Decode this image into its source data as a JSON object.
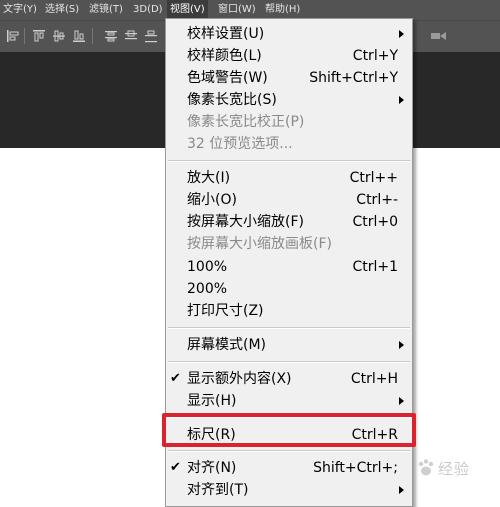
{
  "menubar": {
    "items": [
      {
        "label": "文字(Y)"
      },
      {
        "label": "选择(S)"
      },
      {
        "label": "滤镜(T)"
      },
      {
        "label": "3D(D)"
      },
      {
        "label": "视图(V)"
      },
      {
        "label": "窗口(W)"
      },
      {
        "label": "帮助(H)"
      }
    ]
  },
  "view_menu": {
    "items": [
      {
        "label": "校样设置(U)",
        "shortcut": "",
        "submenu": true
      },
      {
        "label": "校样颜色(L)",
        "shortcut": "Ctrl+Y"
      },
      {
        "label": "色域警告(W)",
        "shortcut": "Shift+Ctrl+Y"
      },
      {
        "label": "像素长宽比(S)",
        "shortcut": "",
        "submenu": true
      },
      {
        "label": "像素长宽比校正(P)",
        "shortcut": "",
        "disabled": true
      },
      {
        "label": "32 位预览选项...",
        "shortcut": "",
        "disabled": true
      },
      {
        "label": "放大(I)",
        "shortcut": "Ctrl++"
      },
      {
        "label": "缩小(O)",
        "shortcut": "Ctrl+-"
      },
      {
        "label": "按屏幕大小缩放(F)",
        "shortcut": "Ctrl+0"
      },
      {
        "label": "按屏幕大小缩放画板(F)",
        "shortcut": "",
        "disabled": true
      },
      {
        "label": "100%",
        "shortcut": "Ctrl+1"
      },
      {
        "label": "200%",
        "shortcut": ""
      },
      {
        "label": "打印尺寸(Z)",
        "shortcut": ""
      },
      {
        "label": "屏幕模式(M)",
        "shortcut": "",
        "submenu": true
      },
      {
        "label": "显示额外内容(X)",
        "shortcut": "Ctrl+H",
        "checked": true
      },
      {
        "label": "显示(H)",
        "shortcut": "",
        "submenu": true
      },
      {
        "label": "标尺(R)",
        "shortcut": "Ctrl+R"
      },
      {
        "label": "对齐(N)",
        "shortcut": "Shift+Ctrl+;",
        "checked": true
      },
      {
        "label": "对齐到(T)",
        "shortcut": "",
        "submenu": true
      }
    ],
    "check_mark": "✔"
  },
  "watermark": {
    "text": "经验"
  },
  "colors": {
    "menubar_bg": "#535353",
    "dropdown_bg": "#f0f0f0",
    "highlight_border": "#d9232e",
    "disabled_text": "#8a8a8a"
  }
}
